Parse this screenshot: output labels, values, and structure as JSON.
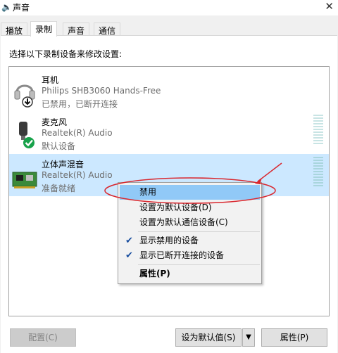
{
  "window": {
    "title": "声音"
  },
  "tabs": [
    {
      "label": "播放"
    },
    {
      "label": "录制"
    },
    {
      "label": "声音"
    },
    {
      "label": "通信"
    }
  ],
  "instructions": "选择以下录制设备来修改设置:",
  "devices": [
    {
      "name": "耳机",
      "sub": "Philips SHB3060 Hands-Free",
      "status": "已禁用，已断开连接",
      "icon": "headset-icon"
    },
    {
      "name": "麦克风",
      "sub": "Realtek(R) Audio",
      "status": "默认设备",
      "icon": "microphone-icon"
    },
    {
      "name": "立体声混音",
      "sub": "Realtek(R) Audio",
      "status": "准备就绪",
      "icon": "sound-card-icon",
      "selected": true
    }
  ],
  "context_menu": {
    "items": [
      {
        "label": "禁用"
      },
      {
        "label": "设置为默认设备(D)"
      },
      {
        "label": "设置为默认通信设备(C)"
      },
      {
        "label": "显示禁用的设备",
        "checked": true
      },
      {
        "label": "显示已断开连接的设备",
        "checked": true
      },
      {
        "label": "属性(P)",
        "bold": true
      }
    ]
  },
  "buttons": {
    "configure": "配置(C)",
    "set_default": "设为默认值(S)",
    "properties": "属性(P)"
  },
  "colors": {
    "selection": "#cce8ff",
    "menu_hover": "#91c9f7",
    "annotation": "#d9272e",
    "check_green": "#17a24a"
  }
}
